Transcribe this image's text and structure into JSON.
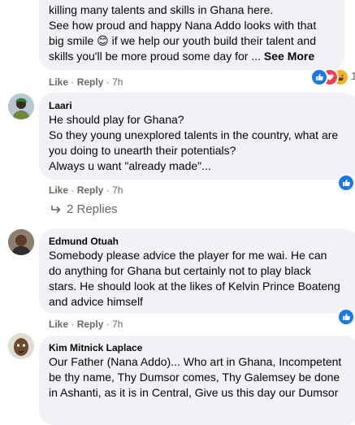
{
  "comments": [
    {
      "author": "",
      "text_lines": [
        "killing many talents and skills in Ghana here.",
        "See how proud and happy Nana Addo looks with that",
        "big smile 😊 if we help our youth build their talent and",
        "skills you'll be more proud some day for ..."
      ],
      "see_more": "See More",
      "like": "Like",
      "reply": "Reply",
      "time": "7h",
      "reaction_count": "1"
    },
    {
      "author": "Laari",
      "text": "He should play for Ghana?\nSo they young unexplored talents in the country, what are\nyou doing to unearth their potentials?\nAlways u want \"already made\"...",
      "like": "Like",
      "reply": "Reply",
      "time": "7h",
      "replies_label": "2 Replies"
    },
    {
      "author": "Edmund Otuah",
      "text": "Somebody please advice the player for me wai. He can\ndo anything for Ghana but certainly not to play black\nstars. He should look at the likes of Kelvin Prince Boateng\nand advice himself",
      "like": "Like",
      "reply": "Reply",
      "time": "7h"
    },
    {
      "author": "Kim Mitnick Laplace",
      "text": "Our Father (Nana Addo)... Who art in Ghana, Incompetent\nbe thy name, Thy Dumsor comes, Thy Galemsey be done\nin Ashanti, as it is in Central, Give us this day our Dumsor"
    }
  ],
  "separator": "·",
  "colors": {
    "bubble": "#f0f2f5",
    "meta_text": "#65676b",
    "like_blue": "#1877f2",
    "love_red": "#f33e58",
    "haha_yellow": "#f7b125"
  },
  "icons": [
    "like-reaction-icon",
    "love-reaction-icon",
    "haha-reaction-icon",
    "reply-arrow-icon",
    "avatar"
  ]
}
